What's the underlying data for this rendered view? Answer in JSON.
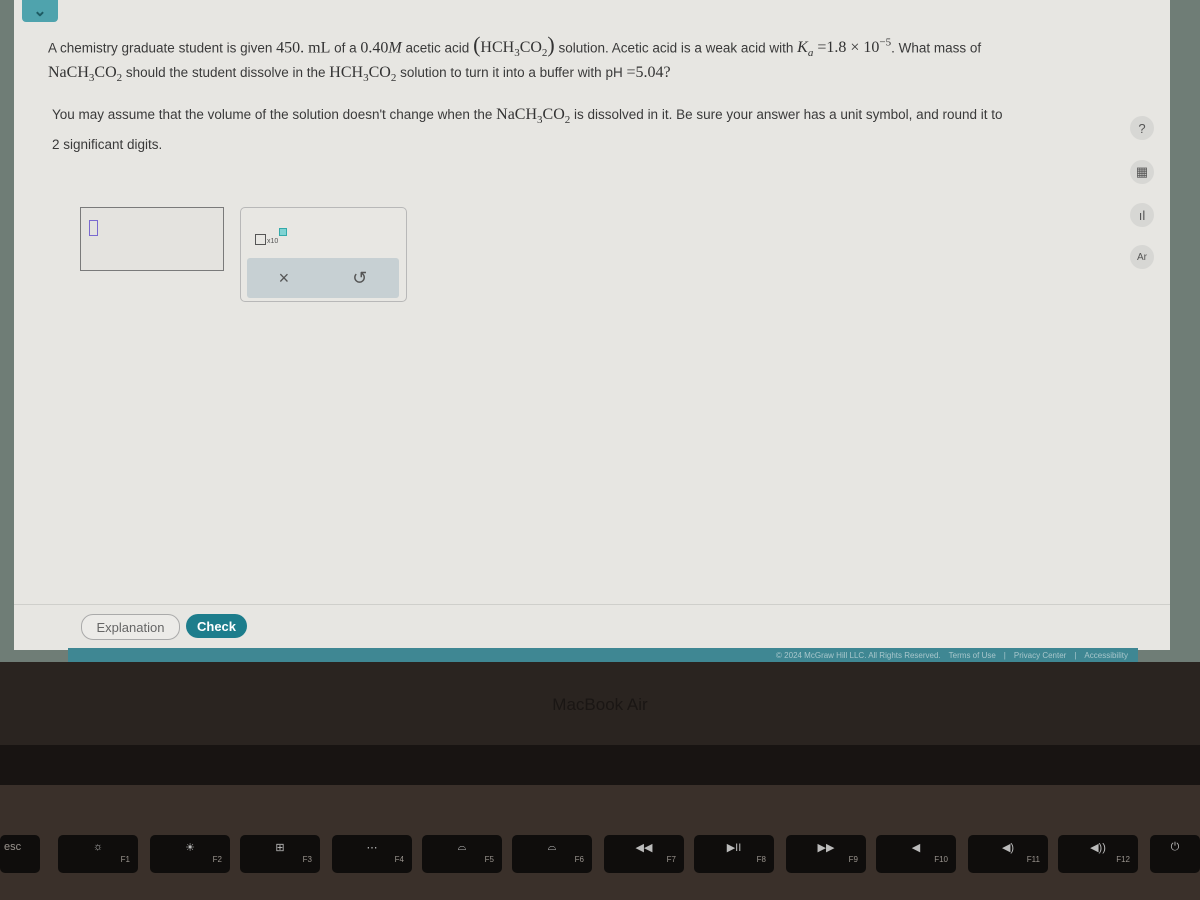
{
  "question": {
    "line1_a": "A chemistry graduate student is given",
    "volume": "450. mL",
    "line1_b": "of a",
    "conc": "0.40",
    "conc_unit": "M",
    "line1_c": "acetic acid",
    "formula_acid": "HCH",
    "line1_d": "solution. Acetic acid is a weak acid with",
    "ka_sym": "K",
    "ka_sub": "a",
    "ka_val": "=1.8 × 10",
    "ka_exp": "−5",
    "line1_e": ". What mass of",
    "salt": "NaCH",
    "line2_a": "should the student dissolve in the",
    "line2_b": "solution to turn it into a buffer with pH",
    "ph": "=5.04?",
    "line3_a": "You may assume that the volume of the solution doesn't change when the",
    "line3_b": "is dissolved in it. Be sure your answer has a unit symbol, and round it to",
    "line4": "2 significant digits.",
    "sub3": "3",
    "co": "CO",
    "sub2": "2"
  },
  "answer": {
    "value": "",
    "sci_label": "x10"
  },
  "pad": {
    "clear": "×",
    "undo": "↺"
  },
  "tools": {
    "help": "?",
    "calc": "▦",
    "chart": "ıl",
    "periodic": "Ar"
  },
  "buttons": {
    "explanation": "Explanation",
    "check": "Check"
  },
  "footer": {
    "copyright": "© 2024 McGraw Hill LLC. All Rights Reserved.",
    "terms": "Terms of Use",
    "privacy": "Privacy Center",
    "access": "Accessibility"
  },
  "device": {
    "label": "MacBook Air"
  },
  "keys": [
    {
      "glyph": "",
      "label": "esc"
    },
    {
      "glyph": "☼",
      "label": "F1"
    },
    {
      "glyph": "☀",
      "label": "F2"
    },
    {
      "glyph": "⊞",
      "label": "F3"
    },
    {
      "glyph": "⋯",
      "label": "F4"
    },
    {
      "glyph": "⌓",
      "label": "F5"
    },
    {
      "glyph": "⌓",
      "label": "F6"
    },
    {
      "glyph": "◀◀",
      "label": "F7"
    },
    {
      "glyph": "▶II",
      "label": "F8"
    },
    {
      "glyph": "▶▶",
      "label": "F9"
    },
    {
      "glyph": "◀",
      "label": "F10"
    },
    {
      "glyph": "◀)",
      "label": "F11"
    },
    {
      "glyph": "◀))",
      "label": "F12"
    },
    {
      "glyph": "⏻",
      "label": ""
    }
  ]
}
